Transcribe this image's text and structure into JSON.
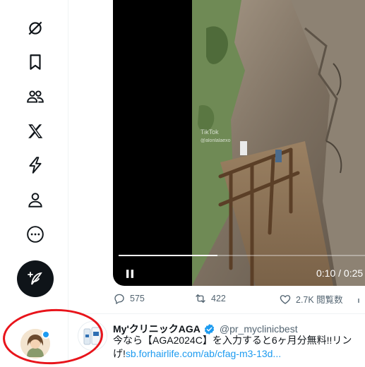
{
  "sidebar": {
    "nav": [
      {
        "name": "grok-icon"
      },
      {
        "name": "bookmark-icon"
      },
      {
        "name": "communities-icon"
      },
      {
        "name": "x-premium-icon"
      },
      {
        "name": "verified-orgs-icon"
      },
      {
        "name": "profile-icon"
      },
      {
        "name": "more-icon"
      }
    ],
    "compose_icon": "feather-plus-icon",
    "notification_dot_color": "#1d9bf0"
  },
  "video": {
    "current_time": "0:10",
    "separator": " / ",
    "duration": "0:25",
    "progress_fraction": 0.4,
    "watermark_label": "TikTok",
    "watermark_handle": "@alonlalaexo"
  },
  "tweet_actions": {
    "replies": "575",
    "retweets": "422",
    "likes": "2.7K 閲覧数"
  },
  "ad": {
    "name": "My'クリニックAGA",
    "handle": "@pr_myclinicbest",
    "line1": "今なら【AGA2024C】を入力すると6ヶ月分無料!!リン",
    "line2_prefix": "げ!",
    "link": "sb.forhairlife.com/ab/cfag-m3-13d..."
  },
  "colors": {
    "accent": "#1d9bf0",
    "annotation": "#e8141b",
    "text": "#0f1419",
    "muted": "#536471"
  }
}
